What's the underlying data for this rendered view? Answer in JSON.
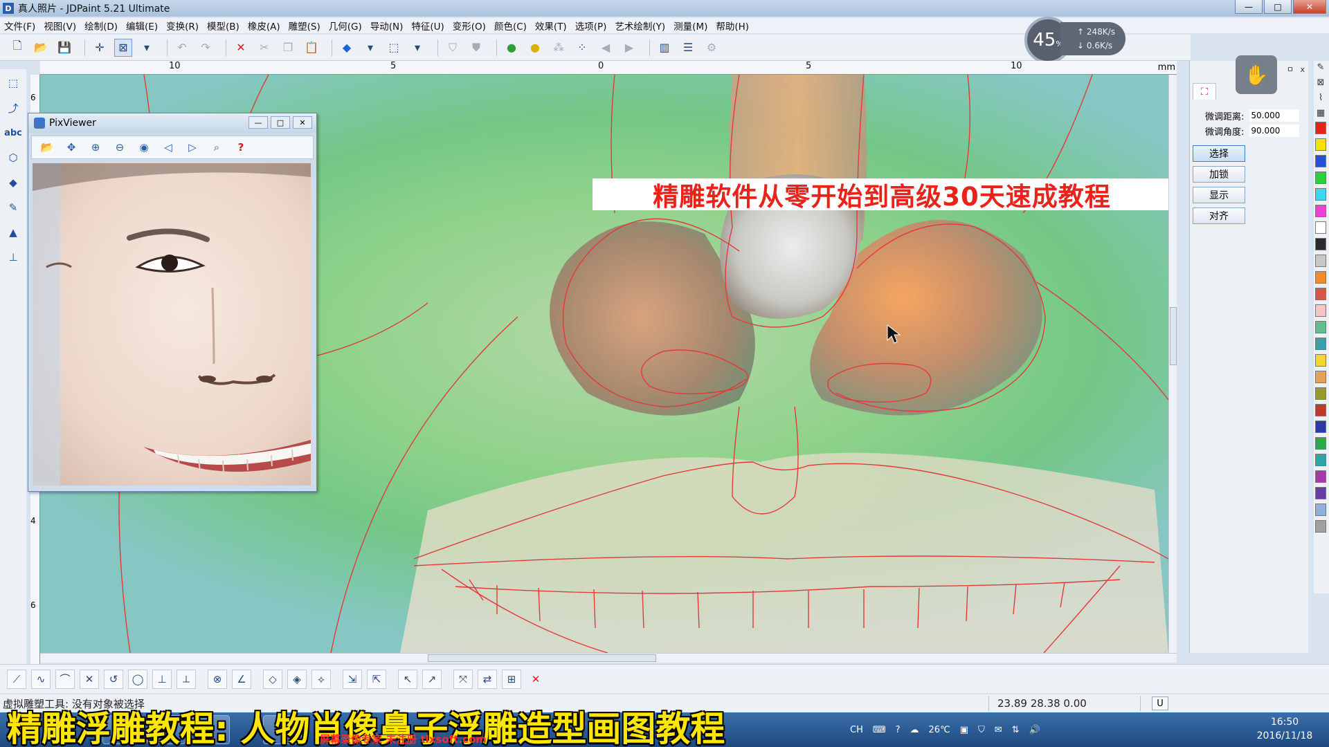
{
  "window": {
    "title": "真人照片 - JDPaint 5.21 Ultimate",
    "minimize": "—",
    "maximize": "□",
    "close": "✕"
  },
  "menu": [
    "文件(F)",
    "视图(V)",
    "绘制(D)",
    "编辑(E)",
    "变换(R)",
    "模型(B)",
    "橡皮(A)",
    "雕塑(S)",
    "几何(G)",
    "导动(N)",
    "特征(U)",
    "变形(O)",
    "颜色(C)",
    "效果(T)",
    "选项(P)",
    "艺术绘制(Y)",
    "测量(M)",
    "帮助(H)"
  ],
  "speed": {
    "percent": "45",
    "percent_unit": "%",
    "upload": "248K/s",
    "download": "0.6K/s"
  },
  "ruler": {
    "unit": "mm",
    "top_ticks": [
      "10",
      "5",
      "0",
      "5",
      "10"
    ],
    "left_ticks": [
      "6",
      "4",
      "6"
    ]
  },
  "banner": {
    "text": "精雕软件从零开始到高级30天速成教程"
  },
  "pixviewer": {
    "title": "PixViewer",
    "minimize": "—",
    "maximize": "□",
    "close": "✕",
    "help": "?"
  },
  "right_panel": {
    "fine_distance_label": "微调距离:",
    "fine_distance_value": "50.000",
    "fine_angle_label": "微调角度:",
    "fine_angle_value": "90.000",
    "buttons": [
      "选择",
      "加锁",
      "显示",
      "对齐"
    ],
    "mini_controls": "ㅁ x"
  },
  "palette": [
    "#e8231b",
    "#f5e400",
    "#2450d8",
    "#2bd13a",
    "#3bd6f0",
    "#ef3fd6",
    "#ffffff",
    "#2a2a2a",
    "#c8c8c8",
    "#f08a2a",
    "#d8564a",
    "#f6c6c6",
    "#5fbf8a",
    "#3aa1a8",
    "#f5d630",
    "#e5a35a",
    "#9a9a2a",
    "#c03a2a",
    "#2a3aa8",
    "#2aa84a",
    "#2aa8a8",
    "#a83aa8",
    "#6a3aa8",
    "#8fb0d8",
    "#a0a0a0"
  ],
  "status": {
    "message": "虚拟雕塑工具: 没有对象被选择",
    "coords": "23.89 28.38 0.00",
    "mode": "U"
  },
  "taskbar": {
    "tray_lang": "CH",
    "temperature": "26℃",
    "time": "16:50",
    "date": "2016/11/18"
  },
  "subtitle": "精雕浮雕教程: 人物肖像鼻子浮雕造型画图教程",
  "watermark": "屏幕录像专家 未注册 tlxsoft.com"
}
